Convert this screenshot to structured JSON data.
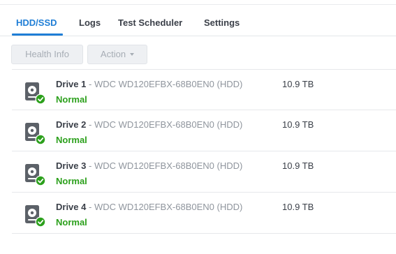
{
  "tabs": [
    {
      "label": "HDD/SSD"
    },
    {
      "label": "Logs"
    },
    {
      "label": "Test Scheduler"
    },
    {
      "label": "Settings"
    }
  ],
  "toolbar": {
    "health_info_label": "Health Info",
    "action_label": "Action"
  },
  "colors": {
    "accent": "#1f7ed6",
    "status_ok": "#2ca01c"
  },
  "drives": [
    {
      "name": "Drive 1",
      "model": "- WDC WD120EFBX-68B0EN0 (HDD)",
      "size": "10.9 TB",
      "status": "Normal",
      "icon": "hdd-icon"
    },
    {
      "name": "Drive 2",
      "model": "- WDC WD120EFBX-68B0EN0 (HDD)",
      "size": "10.9 TB",
      "status": "Normal",
      "icon": "hdd-icon"
    },
    {
      "name": "Drive 3",
      "model": "- WDC WD120EFBX-68B0EN0 (HDD)",
      "size": "10.9 TB",
      "status": "Normal",
      "icon": "hdd-icon"
    },
    {
      "name": "Drive 4",
      "model": "- WDC WD120EFBX-68B0EN0 (HDD)",
      "size": "10.9 TB",
      "status": "Normal",
      "icon": "hdd-icon"
    }
  ]
}
